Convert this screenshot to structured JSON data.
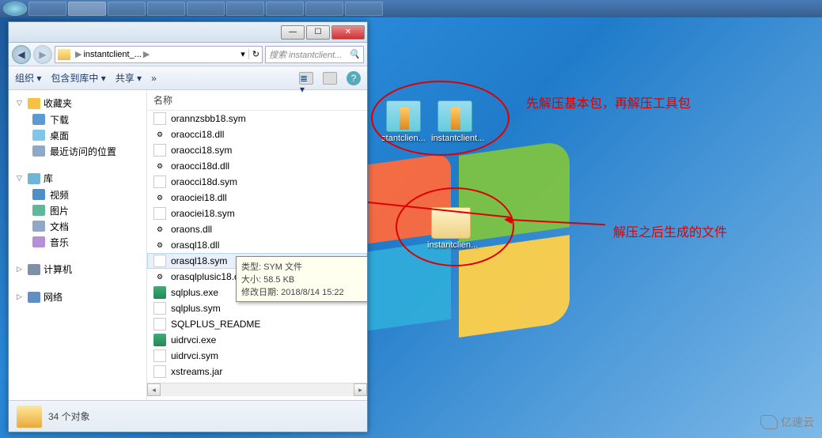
{
  "taskbar": {
    "items": 9
  },
  "explorer": {
    "address": {
      "path_segment": "instantclient_...",
      "dropdown": "▶"
    },
    "search": {
      "placeholder": "搜索 instantclient..."
    },
    "toolbar": {
      "organize": "组织 ▾",
      "include": "包含到库中 ▾",
      "share": "共享 ▾",
      "new_folder": "»"
    },
    "nav": {
      "favorites": "收藏夹",
      "downloads": "下载",
      "desktop": "桌面",
      "recent": "最近访问的位置",
      "libraries": "库",
      "videos": "视频",
      "pictures": "图片",
      "documents": "文档",
      "music": "音乐",
      "computer": "计算机",
      "network": "网络"
    },
    "list_header": "名称",
    "files": [
      {
        "name": "orannzsbb18.sym",
        "type": "page"
      },
      {
        "name": "oraocci18.dll",
        "type": "dll"
      },
      {
        "name": "oraocci18.sym",
        "type": "page"
      },
      {
        "name": "oraocci18d.dll",
        "type": "dll"
      },
      {
        "name": "oraocci18d.sym",
        "type": "page"
      },
      {
        "name": "oraociei18.dll",
        "type": "dll"
      },
      {
        "name": "oraociei18.sym",
        "type": "page"
      },
      {
        "name": "oraons.dll",
        "type": "dll"
      },
      {
        "name": "orasql18.dll",
        "type": "dll"
      },
      {
        "name": "orasql18.sym",
        "type": "page",
        "hover": true
      },
      {
        "name": "orasqlplusic18.dll",
        "type": "dll"
      },
      {
        "name": "sqlplus.exe",
        "type": "exe"
      },
      {
        "name": "sqlplus.sym",
        "type": "page"
      },
      {
        "name": "SQLPLUS_README",
        "type": "txt"
      },
      {
        "name": "uidrvci.exe",
        "type": "exe"
      },
      {
        "name": "uidrvci.sym",
        "type": "page"
      },
      {
        "name": "xstreams.jar",
        "type": "page"
      }
    ],
    "tooltip": {
      "line1": "类型: SYM 文件",
      "line2": "大小: 58.5 KB",
      "line3": "修改日期: 2018/8/14 15:22"
    },
    "status": "34 个对象"
  },
  "desktop_icons": {
    "zip1": "stantclien...",
    "zip2": "instantclient...",
    "folder": "instantclien..."
  },
  "annotations": {
    "top": "先解压基本包，再解压工具包",
    "right": "解压之后生成的文件"
  },
  "watermark": "亿速云"
}
